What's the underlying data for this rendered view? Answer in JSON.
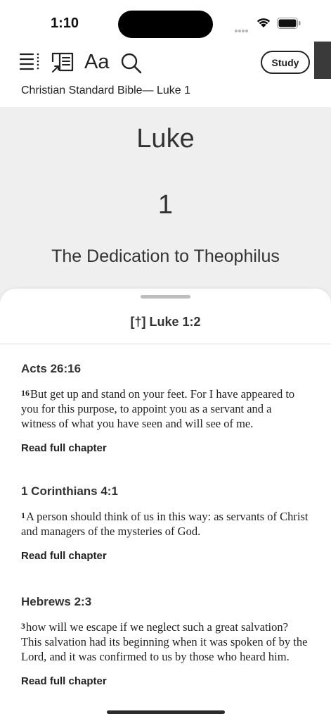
{
  "status": {
    "time": "1:10"
  },
  "toolbar": {
    "icons": [
      "list-menu-icon",
      "reader-view-icon",
      "text-size-icon",
      "search-icon"
    ],
    "text_size_label": "Aa",
    "study_label": "Study",
    "breadcrumb": "Christian Standard Bible— Luke 1"
  },
  "chapter": {
    "book": "Luke",
    "number": "1",
    "section_title": "The Dedication to Theophilus"
  },
  "sheet": {
    "title": "[†] Luke 1:2",
    "xrefs": [
      {
        "ref": "Acts 26:16",
        "verse_num": "16",
        "text": "But get up and stand on your feet. For I have appeared to you for this purpose, to appoint you as a servant and a witness of what you have seen and will see of me.",
        "link": "Read full chapter"
      },
      {
        "ref": "1 Corinthians 4:1",
        "verse_num": "1",
        "text": "A person should think of us in this way: as servants of Christ and managers of the mysteries of God.",
        "link": "Read full chapter"
      },
      {
        "ref": "Hebrews 2:3",
        "verse_num": "3",
        "text": "how will we escape if we neglect such a great salvation? This salvation had its beginning when it was spoken of by the Lord, and it was confirmed to us by those who heard him.",
        "link": "Read full chapter"
      }
    ]
  }
}
